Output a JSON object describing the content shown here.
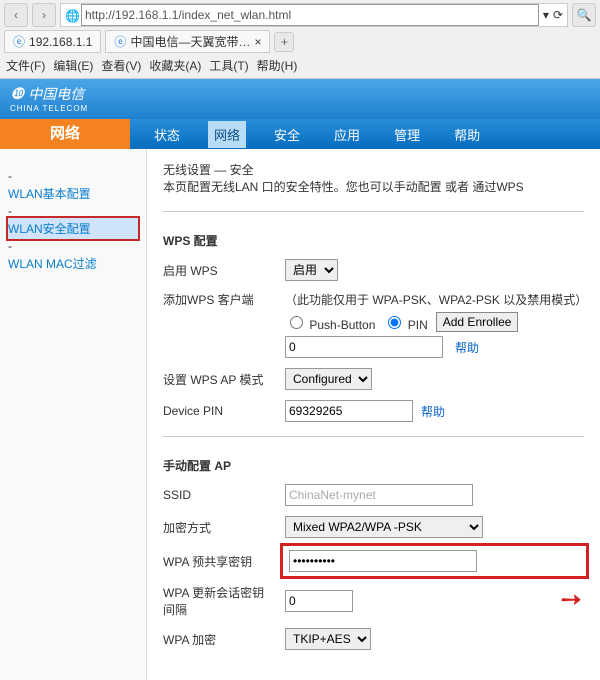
{
  "browser": {
    "url": "http://192.168.1.1/index_net_wlan.html",
    "tab1_label": "192.168.1.1",
    "tab2_label": "中国电信—天翼宽带…",
    "back_icon": "‹",
    "fwd_icon": "›",
    "refresh_icon": "⟳",
    "search_icon": "🔍",
    "tab_close": "×",
    "new_tab": "+"
  },
  "menus": {
    "file": "文件(F)",
    "edit": "编辑(E)",
    "view": "查看(V)",
    "favorites": "收藏夹(A)",
    "tools": "工具(T)",
    "help": "帮助(H)"
  },
  "brand": {
    "name": "中国电信",
    "sub": "CHINA TELECOM"
  },
  "nav": {
    "side_head": "网络",
    "items": [
      "状态",
      "网络",
      "安全",
      "应用",
      "管理",
      "帮助"
    ],
    "active_index": 1
  },
  "sidebar": {
    "items": [
      {
        "label": "WLAN基本配置",
        "hl": false
      },
      {
        "label": "WLAN安全配置",
        "hl": true
      },
      {
        "label": "WLAN MAC过滤",
        "hl": false
      }
    ]
  },
  "page": {
    "title": "无线设置 — 安全",
    "desc": "本页配置无线LAN 口的安全特性。您也可以手动配置 或者 通过WPS"
  },
  "wps": {
    "section": "WPS 配置",
    "enable_label": "启用 WPS",
    "enable_value": "启用",
    "addclient_label": "添加WPS 客户端",
    "addclient_hint": "（此功能仅用于 WPA-PSK、WPA2-PSK 以及禁用模式）",
    "push_label": "Push-Button",
    "pin_label": "PIN",
    "add_btn": "Add Enrollee",
    "pin_input_value": "0",
    "help": "帮助",
    "apmode_label": "设置 WPS AP 模式",
    "apmode_value": "Configured",
    "devpin_label": "Device PIN",
    "devpin_value": "69329265"
  },
  "manual": {
    "section": "手动配置 AP",
    "ssid_label": "SSID",
    "ssid_value": "ChinaNet-mynet",
    "enc_label": "加密方式",
    "enc_value": "Mixed WPA2/WPA -PSK",
    "psk_label": "WPA 预共享密钥",
    "psk_value": "••••••••••",
    "rekey_label": "WPA 更新会话密钥间隔",
    "rekey_value": "0",
    "wpa_enc_label": "WPA 加密",
    "wpa_enc_value": "TKIP+AES"
  }
}
